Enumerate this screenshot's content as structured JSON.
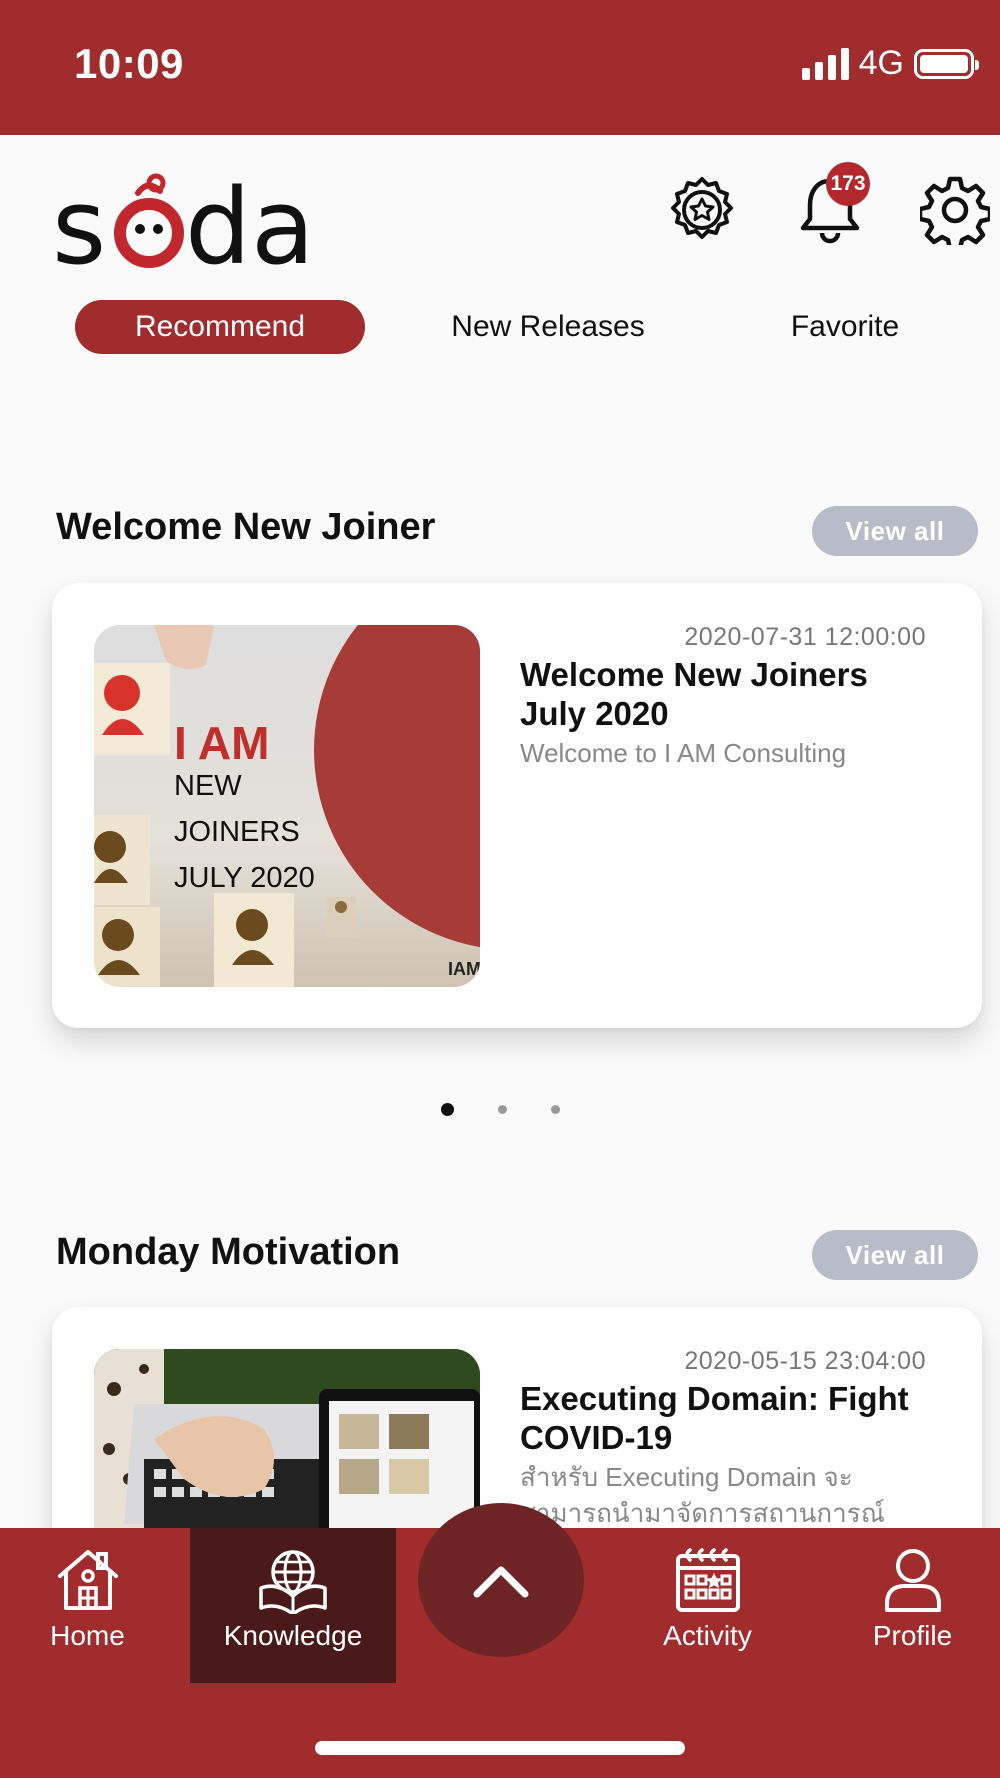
{
  "status": {
    "time": "10:09",
    "network": "4G"
  },
  "header": {
    "logo_text": "soda",
    "notification_count": "173"
  },
  "tabs": [
    {
      "label": "Recommend",
      "active": true
    },
    {
      "label": "New Releases",
      "active": false
    },
    {
      "label": "Favorite",
      "active": false
    }
  ],
  "sections": [
    {
      "title": "Welcome New Joiner",
      "view_all": "View all",
      "card": {
        "date": "2020-07-31 12:00:00",
        "title": "Welcome New Joiners July 2020",
        "desc": "Welcome to I AM Consulting",
        "thumb": {
          "line1": "I AM",
          "line2": "NEW",
          "line3": "JOINERS",
          "line4": "JULY 2020",
          "brand": "IAM"
        }
      }
    },
    {
      "title": "Monday Motivation",
      "view_all": "View all",
      "card": {
        "date": "2020-05-15 23:04:00",
        "title": "Executing Domain: Fight COVID-19",
        "desc": "สำหรับ Executing Domain จะสามารถนำมาจัดการสถานการณ์"
      }
    }
  ],
  "carousel": {
    "pages": 3,
    "active": 0
  },
  "nav": {
    "home": "Home",
    "knowledge": "Knowledge",
    "activity": "Activity",
    "profile": "Profile",
    "active": "knowledge"
  },
  "colors": {
    "brand": "#a02c2d",
    "nav_active": "#4a1a1a",
    "fab": "#6e2424",
    "view_all_bg": "#b8bcc8"
  },
  "icons": [
    "signal-icon",
    "battery-icon",
    "award-badge-icon",
    "bell-icon",
    "gear-icon",
    "home-icon",
    "globe-book-icon",
    "chevron-up-icon",
    "calendar-icon",
    "user-icon"
  ]
}
